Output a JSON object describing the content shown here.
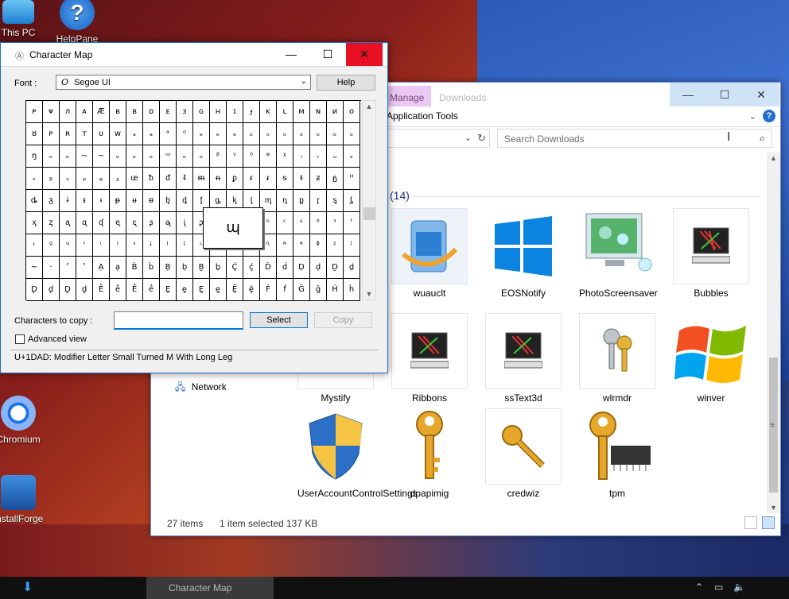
{
  "desktop": {
    "icons": [
      {
        "label": "This PC"
      },
      {
        "label": "HelpPane"
      },
      {
        "label": "Chromium"
      },
      {
        "label": "InstallForge"
      }
    ]
  },
  "explorer": {
    "tabs": {
      "manage": "Manage",
      "downloads": "Downloads"
    },
    "ribbon_tools": "Application Tools",
    "search_placeholder": "Search Downloads",
    "group_count": "(14)",
    "nav_network": "Network",
    "status": {
      "items": "27 items",
      "selected": "1 item selected",
      "size": "137 KB"
    },
    "files": [
      {
        "name": "wuauclt",
        "icon": "windows-update-icon"
      },
      {
        "name": "EOSNotify",
        "icon": "windows-logo-icon"
      },
      {
        "name": "PhotoScreensaver",
        "icon": "photo-screensaver-icon"
      },
      {
        "name": "Bubbles",
        "icon": "screensaver-monitor-icon"
      },
      {
        "name": "Mystify",
        "icon": "screensaver-monitor-icon"
      },
      {
        "name": "Ribbons",
        "icon": "screensaver-monitor-icon"
      },
      {
        "name": "ssText3d",
        "icon": "screensaver-monitor-icon"
      },
      {
        "name": "wlrmdr",
        "icon": "keys-icon"
      },
      {
        "name": "winver",
        "icon": "windows-flag-icon"
      },
      {
        "name": "UserAccountControlSettings",
        "icon": "uac-shield-icon"
      },
      {
        "name": "dpapimig",
        "icon": "key-icon"
      },
      {
        "name": "credwiz",
        "icon": "key-icon"
      },
      {
        "name": "tpm",
        "icon": "key-chip-icon"
      }
    ]
  },
  "charmap": {
    "title": "Character Map",
    "font_label": "Font :",
    "font_value": "Segoe UI",
    "help_label": "Help",
    "copy_label": "Characters to copy :",
    "select_label": "Select",
    "copy_button": "Copy",
    "advanced_label": "Advanced view",
    "status": "U+1DAD: Modifier Letter Small Turned M With Long Leg",
    "magnified": "ɰ",
    "grid_rows": [
      [
        "ᴘ",
        "ᴪ",
        "л",
        "ᴀ",
        "Æ",
        "ʙ",
        "ʙ",
        "ᴅ",
        "ᴇ",
        "ᴈ",
        "ɢ",
        "ʜ",
        "ɪ",
        "ɟ",
        "ᴋ",
        "ʟ",
        "ᴍ",
        "ɴ",
        "ᴎ",
        "ᴏ"
      ],
      [
        "ȣ",
        "ᴘ",
        "ʀ",
        "ᴛ",
        "ᴜ",
        "ᴡ",
        "ₐ",
        "ₐ",
        "ᵃ",
        "ᵅ",
        "ₑ",
        "ₑ",
        "ₔ",
        "ₒ",
        "ₒ",
        "ₒ",
        "ₒ",
        "ₒ",
        "ₒ",
        "ₒ"
      ],
      [
        "ŋ",
        "ₒ",
        "ₒ",
        "~",
        "~",
        "ₒ",
        "ₒ",
        "ₒ",
        "ᵚ",
        "ₒ",
        "ₒ",
        "ᵝ",
        "ᵞ",
        "ᵟ",
        "ᵠ",
        "ᵡ",
        "ᵢ",
        "ᵣ",
        "ᵤ",
        "ᵥ"
      ],
      [
        "ᵥ",
        "ᵦ",
        "ᵧ",
        "ᵨ",
        "ᵩ",
        "ᵪ",
        "ᵫ",
        "ᵬ",
        "ᵭ",
        "ᵮ",
        "ᵯ",
        "ᵰ",
        "ᵱ",
        "ᵲ",
        "ᵳ",
        "ᵴ",
        "ᵵ",
        "ᵶ",
        "ᵷ",
        "ᵸ"
      ],
      [
        "ȡ",
        "ᵹ",
        "ɨ",
        "ᵻ",
        "ᵼ",
        "ᵽ",
        "ᵾ",
        "ᵿ",
        "ᶀ",
        "ᶁ",
        "ᶂ",
        "ᶃ",
        "ᶄ",
        "ᶅ",
        "ᶆ",
        "ᶇ",
        "ᶈ",
        "ᶉ",
        "ᶊ",
        "ᶋ"
      ],
      [
        "ᶍ",
        "ᶎ",
        "ᶏ",
        "ᶐ",
        "ᶑ",
        "ᶒ",
        "ᶓ",
        "ᶔ",
        "ᶕ",
        "ᶖ",
        "ᶗ",
        "ᶘ",
        "ᶙ",
        "ᶚ",
        "ᶛ",
        "ᶜ",
        "ᶝ",
        "ᶞ",
        "ᶟ",
        "ᶠ"
      ],
      [
        "ᶡ",
        "ᶢ",
        "ᶣ",
        "ᶤ",
        "ᶥ",
        "ᶦ",
        "ᶧ",
        "ᶨ",
        "ᶩ",
        "ᶪ",
        "ᶫ",
        "ᶬ",
        "ᶭ",
        "ᶮ",
        "ᶯ",
        "ᶰ",
        "ᶱ",
        "ᶲ",
        "ᶳ",
        "ᶴ"
      ],
      [
        "~",
        "·",
        "˂",
        "˃",
        "Ạ",
        "ạ",
        "Ḃ",
        "ḃ",
        "Ḅ",
        "ḅ",
        "Ḇ",
        "ḇ",
        "Ḉ",
        "ḉ",
        "Ḋ",
        "ḋ",
        "Ḍ",
        "ḍ",
        "Ḏ",
        "ḏ"
      ],
      [
        "Ḑ",
        "ḑ",
        "Ḓ",
        "ḓ",
        "Ḕ",
        "ḕ",
        "Ḗ",
        "ḗ",
        "Ḙ",
        "ḙ",
        "Ḛ",
        "ḛ",
        "Ḝ",
        "ḝ",
        "Ḟ",
        "ḟ",
        "Ḡ",
        "ḡ",
        "Ḣ",
        "ḣ"
      ]
    ]
  },
  "taskbar": {
    "charmap_label": "Character Map"
  },
  "colors": {
    "accent": "#0078d7",
    "close": "#e81123",
    "manage_tab": "#e9c9f2"
  }
}
